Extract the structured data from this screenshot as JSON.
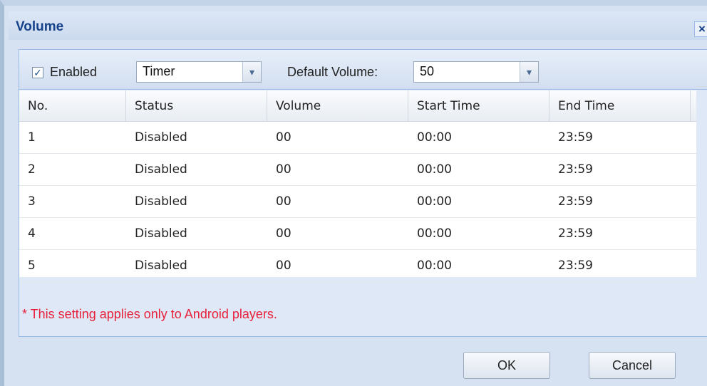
{
  "dialog": {
    "title": "Volume"
  },
  "toolbar": {
    "enabled_label": "Enabled",
    "enabled_checked": true,
    "mode_value": "Timer",
    "default_volume_label": "Default Volume:",
    "default_volume_value": "50"
  },
  "grid": {
    "columns": [
      "No.",
      "Status",
      "Volume",
      "Start Time",
      "End Time"
    ],
    "rows": [
      [
        "1",
        "Disabled",
        "00",
        "00:00",
        "23:59"
      ],
      [
        "2",
        "Disabled",
        "00",
        "00:00",
        "23:59"
      ],
      [
        "3",
        "Disabled",
        "00",
        "00:00",
        "23:59"
      ],
      [
        "4",
        "Disabled",
        "00",
        "00:00",
        "23:59"
      ],
      [
        "5",
        "Disabled",
        "00",
        "00:00",
        "23:59"
      ]
    ]
  },
  "note": "* This setting applies only to Android players.",
  "buttons": {
    "ok": "OK",
    "cancel": "Cancel"
  },
  "icons": {
    "close": "close-icon",
    "checkbox": "check-icon",
    "dropdown": "chevron-down-icon"
  }
}
